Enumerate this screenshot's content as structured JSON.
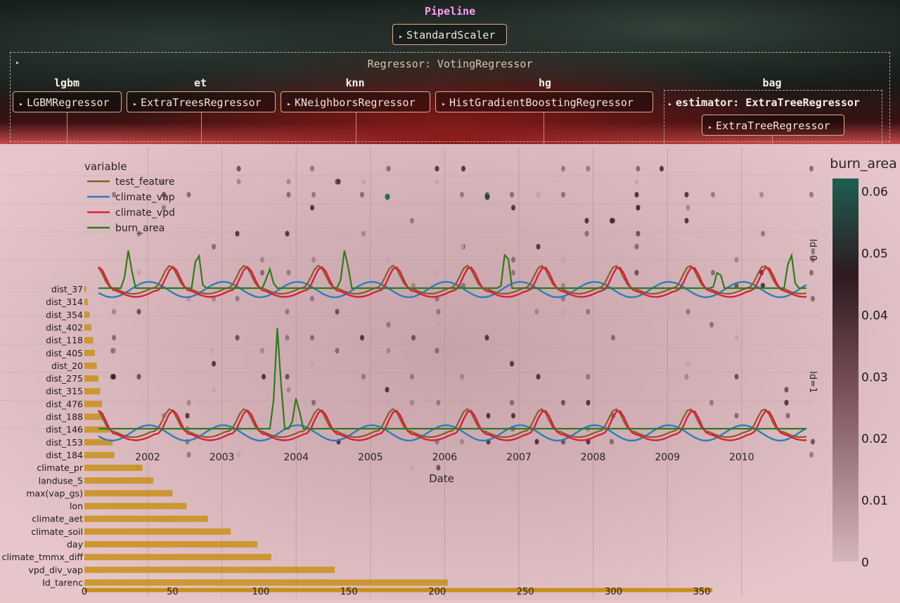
{
  "pipeline": {
    "title": "Pipeline",
    "scaler": "StandardScaler",
    "regressor_label": "Regressor: VotingRegressor",
    "estimators": [
      {
        "name": "lgbm",
        "model": "LGBMRegressor"
      },
      {
        "name": "et",
        "model": "ExtraTreesRegressor"
      },
      {
        "name": "knn",
        "model": "KNeighborsRegressor"
      },
      {
        "name": "hg",
        "model": "HistGradientBoostingRegressor"
      },
      {
        "name": "bag",
        "model": "ExtraTreeRegressor"
      }
    ],
    "bag_estimator_label": "estimator: ExtraTreeRegressor"
  },
  "colors": {
    "test_feature": "#8a5a2a",
    "climate_vap": "#2a7fb8",
    "climate_vpd": "#d8203a",
    "burn_area": "#2e7a1e",
    "bar": "#c8901a",
    "colorbar_low": "#d6b8bc",
    "colorbar_mid": "#3a1a22",
    "colorbar_high": "#1e5e52"
  },
  "chart_data": [
    {
      "type": "line",
      "xlabel": "Date",
      "legend_title": "variable",
      "legend_position": "top-left",
      "x_ticks": [
        "2002",
        "2003",
        "2004",
        "2005",
        "2006",
        "2007",
        "2008",
        "2009",
        "2010"
      ],
      "facets": [
        "Id=0",
        "Id=1"
      ],
      "series": [
        {
          "name": "test_feature"
        },
        {
          "name": "climate_vap"
        },
        {
          "name": "climate_vpd"
        },
        {
          "name": "burn_area"
        }
      ]
    },
    {
      "type": "bar",
      "orientation": "horizontal",
      "categories": [
        "dist_37",
        "dist_314",
        "dist_354",
        "dist_402",
        "dist_118",
        "dist_405",
        "dist_20",
        "dist_275",
        "dist_315",
        "dist_476",
        "dist_188",
        "dist_146",
        "dist_153",
        "dist_184",
        "climate_pr",
        "landuse_5",
        "max(vap_gs)",
        "lon",
        "climate_aet",
        "climate_soil",
        "day",
        "climate_tmmx_diff",
        "vpd_div_vap",
        "Id_tarenc"
      ],
      "values": [
        1,
        2,
        3,
        4,
        5,
        6,
        7,
        8,
        9,
        10,
        11,
        14,
        16,
        17,
        33,
        39,
        50,
        58,
        70,
        83,
        98,
        106,
        142,
        206
      ],
      "extra_last_value": 356,
      "x_ticks": [
        0,
        50,
        100,
        150,
        200,
        250,
        300,
        350
      ],
      "xlim": [
        0,
        360
      ]
    },
    {
      "type": "scatter",
      "colorbar_title": "burn_area",
      "colorbar_ticks": [
        "0",
        "0.01",
        "0.02",
        "0.03",
        "0.04",
        "0.05",
        "0.06"
      ],
      "clim": [
        0,
        0.062
      ]
    }
  ]
}
